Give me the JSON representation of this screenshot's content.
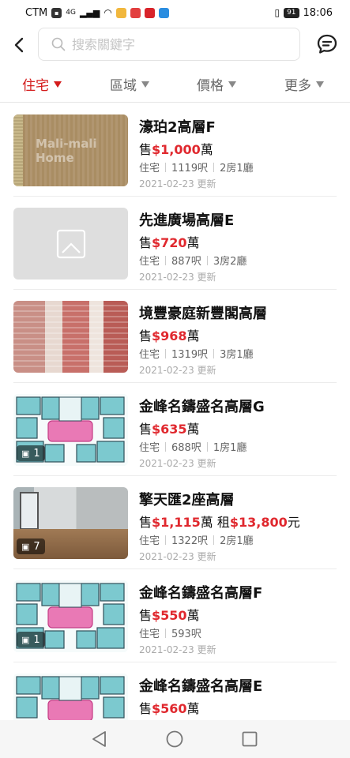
{
  "status": {
    "carrier": "CTM",
    "net": "4G",
    "battery": "91",
    "time": "18:06"
  },
  "search": {
    "placeholder": "搜索關鍵字"
  },
  "filters": [
    {
      "label": "住宅",
      "active": true
    },
    {
      "label": "區域",
      "active": false
    },
    {
      "label": "價格",
      "active": false
    },
    {
      "label": "更多",
      "active": false
    }
  ],
  "listings": [
    {
      "title": "濠珀2高層F",
      "sale_prefix": "售",
      "sale_price": "$1,000",
      "sale_unit": "萬",
      "type": "住宅",
      "area": "1119呎",
      "rooms": "2房1廳",
      "date": "2021-02-23 更新",
      "thumb": "wood",
      "photos": ""
    },
    {
      "title": "先進廣場高層E",
      "sale_prefix": "售",
      "sale_price": "$720",
      "sale_unit": "萬",
      "type": "住宅",
      "area": "887呎",
      "rooms": "3房2廳",
      "date": "2021-02-23 更新",
      "thumb": "empty",
      "photos": ""
    },
    {
      "title": "境豐豪庭新豐閣高層",
      "sale_prefix": "售",
      "sale_price": "$968",
      "sale_unit": "萬",
      "type": "住宅",
      "area": "1319呎",
      "rooms": "3房1廳",
      "date": "2021-02-23 更新",
      "thumb": "tower",
      "photos": ""
    },
    {
      "title": "金峰名鑄盛名高層G",
      "sale_prefix": "售",
      "sale_price": "$635",
      "sale_unit": "萬",
      "type": "住宅",
      "area": "688呎",
      "rooms": "1房1廳",
      "date": "2021-02-23 更新",
      "thumb": "plan",
      "photos": "1"
    },
    {
      "title": "擎天匯2座高層",
      "sale_prefix": "售",
      "sale_price": "$1,115",
      "sale_unit": "萬",
      "rent_prefix": "租",
      "rent_price": "$13,800",
      "rent_unit": "元",
      "type": "住宅",
      "area": "1322呎",
      "rooms": "2房1廳",
      "date": "2021-02-23 更新",
      "thumb": "room",
      "photos": "7"
    },
    {
      "title": "金峰名鑄盛名高層F",
      "sale_prefix": "售",
      "sale_price": "$550",
      "sale_unit": "萬",
      "type": "住宅",
      "area": "593呎",
      "rooms": "",
      "date": "2021-02-23 更新",
      "thumb": "plan",
      "photos": "1"
    },
    {
      "title": "金峰名鑄盛名高層E",
      "sale_prefix": "售",
      "sale_price": "$560",
      "sale_unit": "萬",
      "type": "",
      "area": "",
      "rooms": "",
      "date": "",
      "thumb": "plan",
      "photos": ""
    }
  ],
  "colors": {
    "accent": "#d41c1c",
    "price": "#e0282e"
  }
}
